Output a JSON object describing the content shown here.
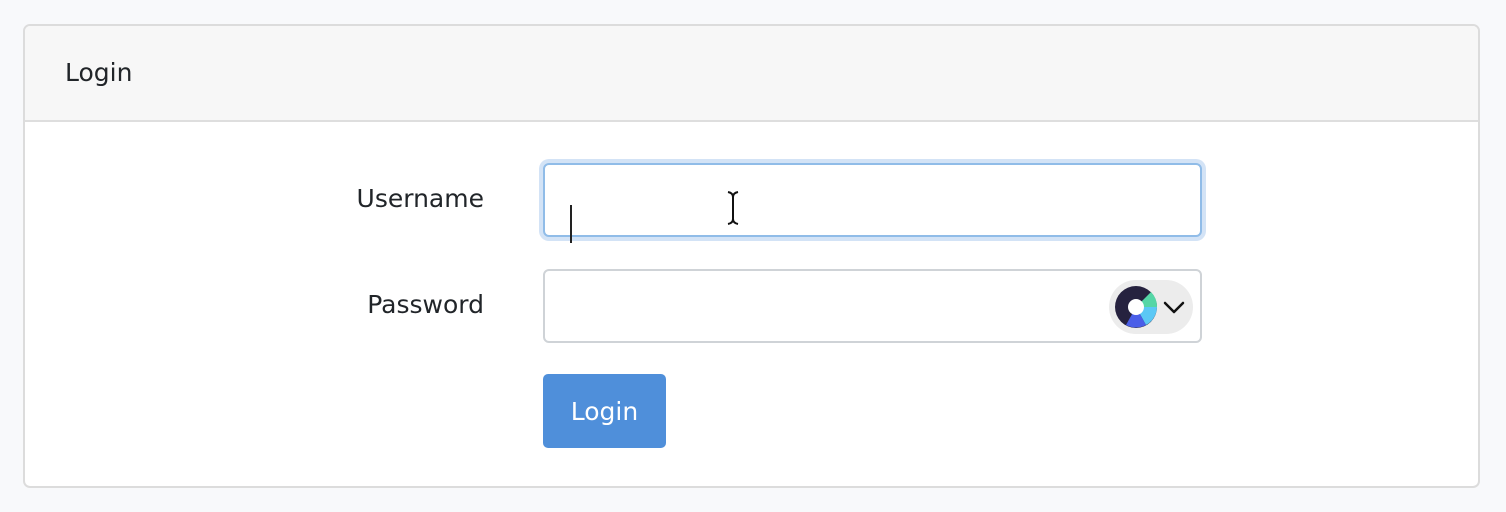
{
  "card": {
    "title": "Login"
  },
  "form": {
    "username_label": "Username",
    "username_value": "",
    "password_label": "Password",
    "password_value": "",
    "submit_label": "Login"
  },
  "password_manager": {
    "icon": "password-manager-icon",
    "chevron_icon": "chevron-down-icon"
  },
  "colors": {
    "primary": "#4f8fda",
    "focus_border": "#90bce8",
    "focus_ring": "#d3e3f6",
    "header_bg": "#f7f7f7"
  }
}
